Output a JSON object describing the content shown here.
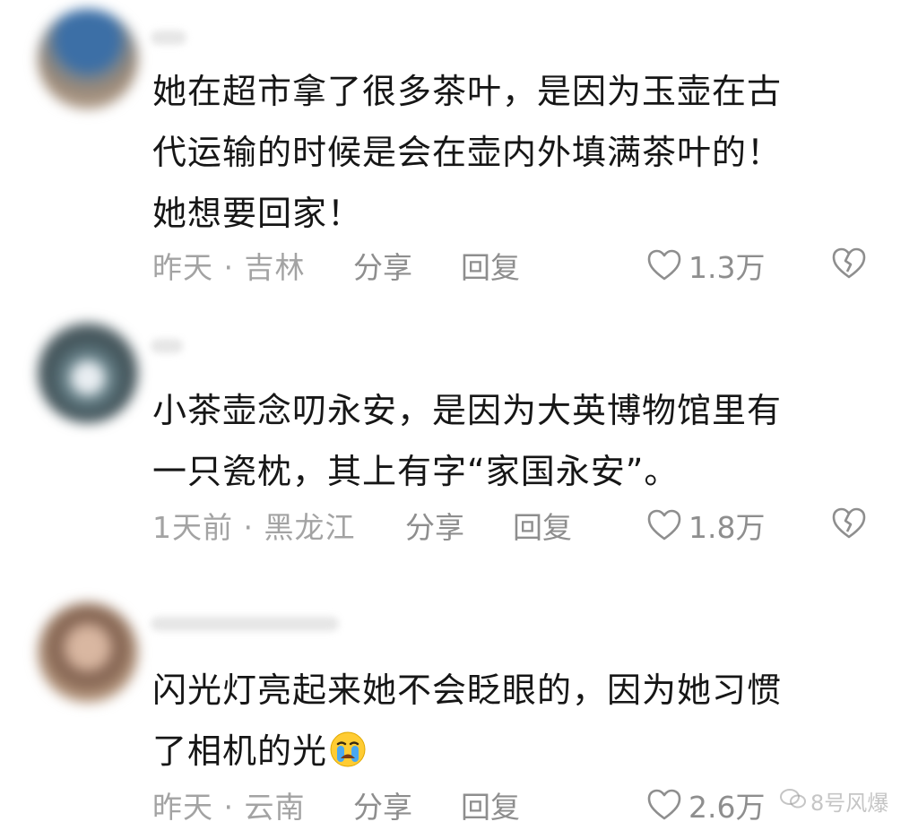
{
  "comments": [
    {
      "text_lines": [
        "她在超市拿了很多茶叶，是因为玉壶在古",
        "代运输的时候是会在壶内外填满茶叶的！",
        "她想要回家！"
      ],
      "meta": "昨天 · 吉林",
      "share_label": "分享",
      "reply_label": "回复",
      "likes": "1.3万"
    },
    {
      "text_lines": [
        "小茶壶念叨永安，是因为大英博物馆里有",
        "一只瓷枕，其上有字“家国永安”。"
      ],
      "meta": "1天前 · 黑龙江",
      "share_label": "分享",
      "reply_label": "回复",
      "likes": "1.8万"
    },
    {
      "text_lines": [
        "闪光灯亮起来她不会眨眼的，因为她习惯",
        "了相机的光"
      ],
      "meta": "昨天 · 云南",
      "share_label": "分享",
      "reply_label": "回复",
      "likes": "2.6万",
      "emoji": "crying-face-emoji"
    }
  ],
  "icons": {
    "like": "heart-outline-icon",
    "dislike": "broken-heart-icon"
  },
  "watermark": "8号风爆",
  "colors": {
    "text": "#161616",
    "meta": "#a3a3a3",
    "action": "#8e8e8e"
  }
}
